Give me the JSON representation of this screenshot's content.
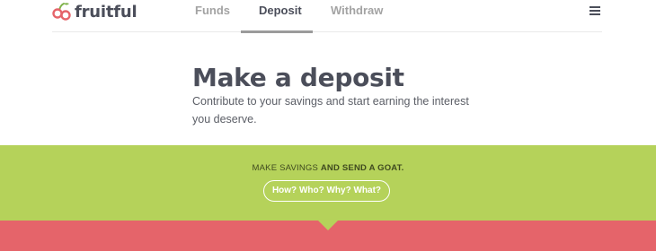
{
  "brand": {
    "name": "fruitful",
    "logo_icon": "cherries-logo-icon"
  },
  "nav": {
    "items": [
      {
        "label": "Funds",
        "active": false
      },
      {
        "label": "Deposit",
        "active": true
      },
      {
        "label": "Withdraw",
        "active": false
      }
    ],
    "menu_icon": "hamburger-menu-icon"
  },
  "hero": {
    "title": "Make a deposit",
    "description": "Contribute to your savings and start earning the interest you deserve."
  },
  "banner": {
    "text_plain": "MAKE SAVINGS",
    "text_bold": "AND SEND A GOAT.",
    "button_label": "How? Who? Why? What?"
  },
  "colors": {
    "brand_green": "#b5d25a",
    "brand_red": "#e5646a",
    "text_dark": "#4b4e5a",
    "nav_inactive": "#a3a3a3"
  }
}
